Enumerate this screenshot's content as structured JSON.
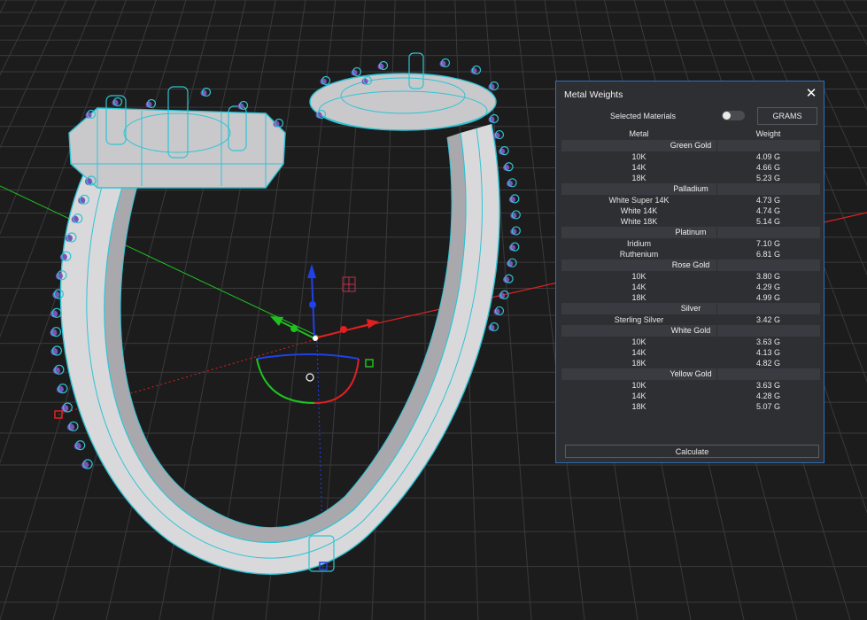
{
  "panel": {
    "title": "Metal Weights",
    "selected_materials_label": "Selected Materials",
    "selected_materials_on": false,
    "units_label": "GRAMS",
    "column_metal": "Metal",
    "column_weight": "Weight",
    "groups": [
      {
        "name": "Green Gold",
        "rows": [
          {
            "metal": "10K",
            "weight": "4.09 G"
          },
          {
            "metal": "14K",
            "weight": "4.66 G"
          },
          {
            "metal": "18K",
            "weight": "5.23 G"
          }
        ]
      },
      {
        "name": "Palladium",
        "rows": [
          {
            "metal": "White Super 14K",
            "weight": "4.73 G"
          },
          {
            "metal": "White 14K",
            "weight": "4.74 G"
          },
          {
            "metal": "White 18K",
            "weight": "5.14 G"
          }
        ]
      },
      {
        "name": "Platinum",
        "rows": [
          {
            "metal": "Iridium",
            "weight": "7.10 G"
          },
          {
            "metal": "Ruthenium",
            "weight": "6.81 G"
          }
        ]
      },
      {
        "name": "Rose Gold",
        "rows": [
          {
            "metal": "10K",
            "weight": "3.80 G"
          },
          {
            "metal": "14K",
            "weight": "4.29 G"
          },
          {
            "metal": "18K",
            "weight": "4.99 G"
          }
        ]
      },
      {
        "name": "Silver",
        "rows": [
          {
            "metal": "Sterling Silver",
            "weight": "3.42 G"
          }
        ]
      },
      {
        "name": "White Gold",
        "rows": [
          {
            "metal": "10K",
            "weight": "3.63 G"
          },
          {
            "metal": "14K",
            "weight": "4.13 G"
          },
          {
            "metal": "18K",
            "weight": "4.82 G"
          }
        ]
      },
      {
        "name": "Yellow Gold",
        "rows": [
          {
            "metal": "10K",
            "weight": "3.63 G"
          },
          {
            "metal": "14K",
            "weight": "4.28 G"
          },
          {
            "metal": "18K",
            "weight": "5.07 G"
          }
        ]
      }
    ],
    "calculate_label": "Calculate"
  },
  "viewport": {
    "background": "#1c1c1d",
    "grid_color": "#3a3a3d",
    "ring_color": "#d9d9db",
    "wire_color": "#2ec4d4",
    "stone_color": "#7a54b8",
    "axis_x_color": "#e02020",
    "axis_y_color": "#20c020",
    "axis_z_color": "#2040e8"
  },
  "icons": [
    "close-icon",
    "transform-gizmo-icon"
  ]
}
